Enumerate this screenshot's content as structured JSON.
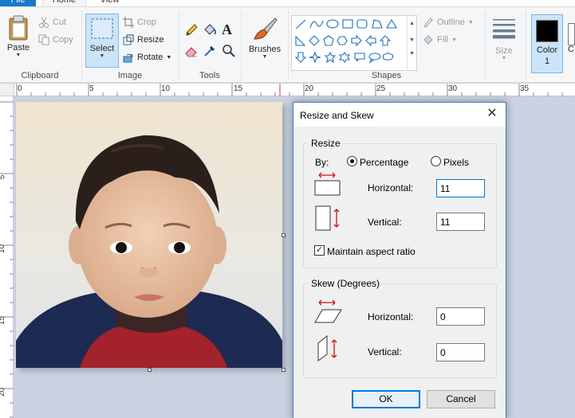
{
  "tabs": {
    "file": "File",
    "home": "Home",
    "view": "View"
  },
  "clipboard": {
    "paste": "Paste",
    "cut": "Cut",
    "copy": "Copy",
    "group": "Clipboard"
  },
  "image": {
    "select": "Select",
    "crop": "Crop",
    "resize": "Resize",
    "rotate": "Rotate",
    "group": "Image"
  },
  "tools": {
    "group": "Tools"
  },
  "brushes": {
    "label": "Brushes"
  },
  "shapes": {
    "outline": "Outline",
    "fill": "Fill",
    "group": "Shapes"
  },
  "size": {
    "label": "Size"
  },
  "colors": {
    "color1": "Color",
    "color1_num": "1",
    "color2_partial": "C",
    "color1_value": "#000000"
  },
  "ruler": {
    "h": [
      "0",
      "5",
      "10",
      "15",
      "20",
      "25",
      "30",
      "35"
    ],
    "v": [
      "5",
      "10",
      "15",
      "20"
    ]
  },
  "dialog": {
    "title": "Resize and Skew",
    "resize_group": "Resize",
    "by": "By:",
    "percentage": "Percentage",
    "pixels": "Pixels",
    "selected_unit": "Percentage",
    "horizontal_label": "Horizontal:",
    "vertical_label": "Vertical:",
    "resize_h": "11",
    "resize_v": "11",
    "maintain": "Maintain aspect ratio",
    "maintain_checked": true,
    "skew_group": "Skew (Degrees)",
    "skew_h": "0",
    "skew_v": "0",
    "ok": "OK",
    "cancel": "Cancel"
  }
}
